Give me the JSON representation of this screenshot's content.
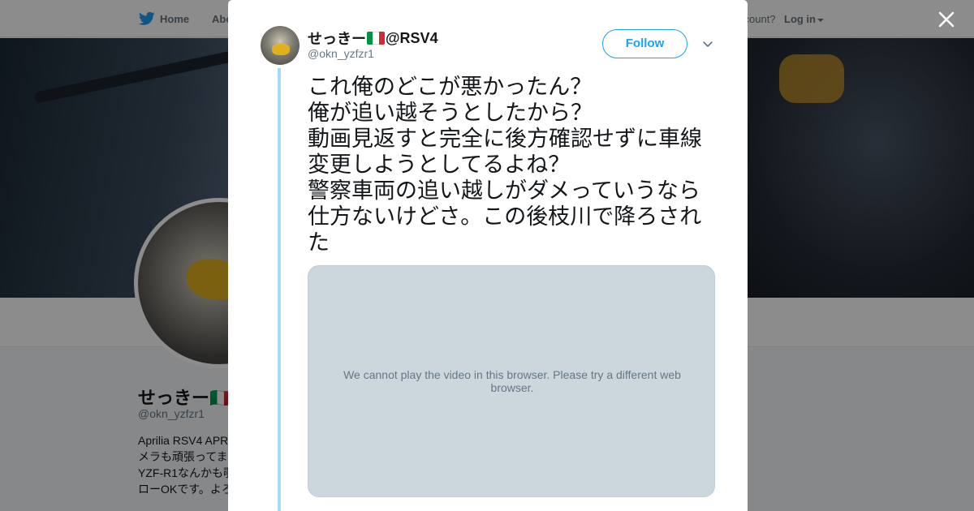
{
  "nav": {
    "home_label": "Home",
    "about_label": "Abo",
    "account_text": "ccount?",
    "login_label": "Log in"
  },
  "profile": {
    "name": "せっきー🇮🇹",
    "handle": "@okn_yzfzr1",
    "bio": "Aprilia RSV4 APR\nメラも頑張ってま\nYZF-R1なんかも覗\nローOKです。よろ"
  },
  "tweet": {
    "display_name_prefix": "せっきー",
    "display_name_suffix": "@RSV4",
    "username": "@okn_yzfzr1",
    "follow_label": "Follow",
    "text": "これ俺のどこが悪かったん？\n俺が追い越そうとしたから？\n動画見返すと完全に後方確認せずに車線変更しようとしてるよね？\n警察車両の追い越しがダメっていうなら仕方ないけどさ。この後枝川で降ろされた",
    "video_message": "We cannot play the video in this browser. Please try a different web browser."
  },
  "colors": {
    "accent": "#1da1f2",
    "thread_line": "#a4d9f9",
    "video_bg": "#ccd6dd"
  },
  "icons": {
    "bird": "twitter-bird-icon",
    "close": "close-icon",
    "caret": "chevron-down-icon",
    "flag": "italy-flag-icon"
  }
}
